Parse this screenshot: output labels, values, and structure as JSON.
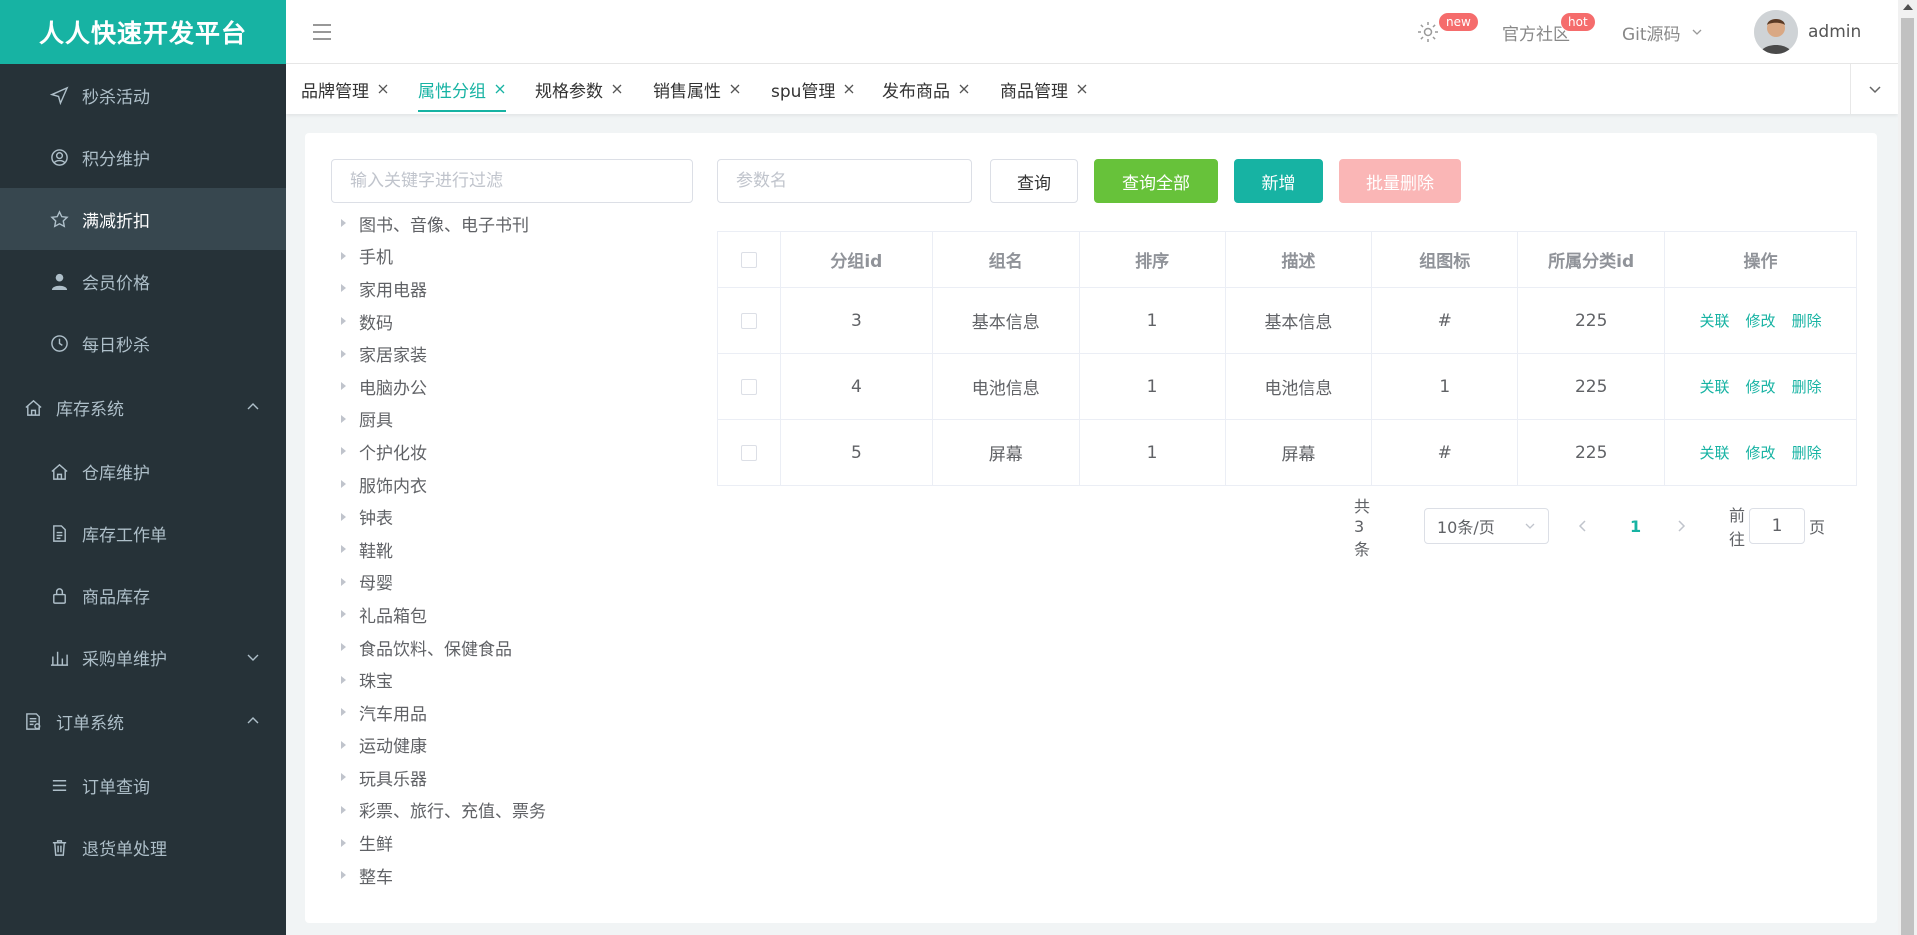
{
  "brand": {
    "title": "人人快速开发平台"
  },
  "sidebar": {
    "items": [
      {
        "label": "秒杀活动",
        "icon": "send-icon",
        "type": "child"
      },
      {
        "label": "积分维护",
        "icon": "user-circle-icon",
        "type": "child"
      },
      {
        "label": "满减折扣",
        "icon": "star-icon",
        "type": "child",
        "active": true
      },
      {
        "label": "会员价格",
        "icon": "user-icon",
        "type": "child"
      },
      {
        "label": "每日秒杀",
        "icon": "clock-icon",
        "type": "child"
      },
      {
        "label": "库存系统",
        "icon": "home-icon",
        "type": "group",
        "arrow": "up"
      },
      {
        "label": "仓库维护",
        "icon": "home-icon",
        "type": "child"
      },
      {
        "label": "库存工作单",
        "icon": "document-icon",
        "type": "child"
      },
      {
        "label": "商品库存",
        "icon": "lock-icon",
        "type": "child"
      },
      {
        "label": "采购单维护",
        "icon": "bar-chart-icon",
        "type": "child",
        "arrow": "down"
      },
      {
        "label": "订单系统",
        "icon": "order-icon",
        "type": "group",
        "arrow": "up"
      },
      {
        "label": "订单查询",
        "icon": "list-icon",
        "type": "child"
      },
      {
        "label": "退货单处理",
        "icon": "trash-icon",
        "type": "child"
      }
    ]
  },
  "header": {
    "badge_new": "new",
    "community": "官方社区",
    "badge_hot": "hot",
    "git": "Git源码",
    "username": "admin"
  },
  "tabs": [
    {
      "label": "品牌管理",
      "active": false
    },
    {
      "label": "属性分组",
      "active": true
    },
    {
      "label": "规格参数",
      "active": false
    },
    {
      "label": "销售属性",
      "active": false
    },
    {
      "label": "spu管理",
      "active": false
    },
    {
      "label": "发布商品",
      "active": false
    },
    {
      "label": "商品管理",
      "active": false
    }
  ],
  "filter": {
    "placeholder": "输入关键字进行过滤"
  },
  "search": {
    "placeholder": "参数名",
    "query_label": "查询",
    "query_all_label": "查询全部",
    "add_label": "新增",
    "batch_delete_label": "批量删除"
  },
  "tree": [
    "图书、音像、电子书刊",
    "手机",
    "家用电器",
    "数码",
    "家居家装",
    "电脑办公",
    "厨具",
    "个护化妆",
    "服饰内衣",
    "钟表",
    "鞋靴",
    "母婴",
    "礼品箱包",
    "食品饮料、保健食品",
    "珠宝",
    "汽车用品",
    "运动健康",
    "玩具乐器",
    "彩票、旅行、充值、票务",
    "生鲜",
    "整车"
  ],
  "table": {
    "columns": [
      "分组id",
      "组名",
      "排序",
      "描述",
      "组图标",
      "所属分类id",
      "操作"
    ],
    "rows": [
      {
        "id": "3",
        "name": "基本信息",
        "sort": "1",
        "desc": "基本信息",
        "icon": "#",
        "catelog": "225"
      },
      {
        "id": "4",
        "name": "电池信息",
        "sort": "1",
        "desc": "电池信息",
        "icon": "1",
        "catelog": "225"
      },
      {
        "id": "5",
        "name": "屏幕",
        "sort": "1",
        "desc": "屏幕",
        "icon": "#",
        "catelog": "225"
      }
    ],
    "actions": {
      "relate": "关联",
      "edit": "修改",
      "delete": "删除"
    }
  },
  "pagination": {
    "total_text": "共 3 条",
    "page_size": "10条/页",
    "current_page": "1",
    "goto_prefix": "前往",
    "goto_value": "1",
    "goto_suffix": "页"
  },
  "colors": {
    "brand": "#17b3a3",
    "sidebar": "#263238",
    "success": "#67c23a",
    "danger": "#f56c6c"
  }
}
